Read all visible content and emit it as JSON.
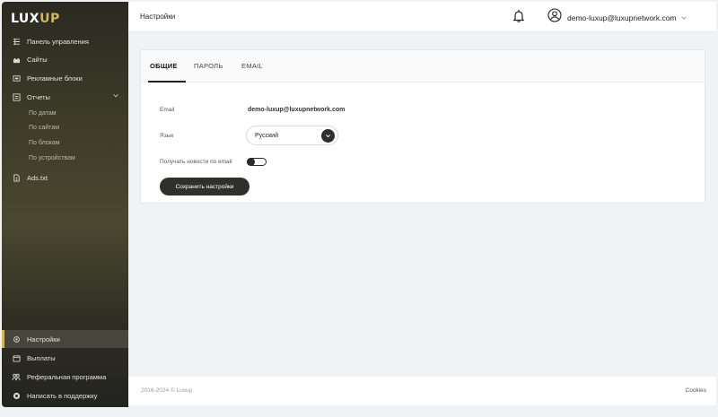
{
  "brand": {
    "logo_main": "LUX",
    "logo_accent": "UP",
    "accent_color": "#d6b94a"
  },
  "sidebar": {
    "items": [
      {
        "label": "Панель управления",
        "icon": "dashboard-icon"
      },
      {
        "label": "Сайты",
        "icon": "sites-icon"
      },
      {
        "label": "Рекламные блоки",
        "icon": "ad-block-icon"
      },
      {
        "label": "Отчеты",
        "icon": "report-icon"
      },
      {
        "label": "Ads.txt",
        "icon": "file-icon"
      }
    ],
    "report_subitems": [
      "По датам",
      "По сайтам",
      "По блокам",
      "По устройствам"
    ],
    "bottom_items": [
      {
        "label": "Настройки",
        "icon": "gear-icon",
        "active": true
      },
      {
        "label": "Выплаты",
        "icon": "wallet-icon"
      },
      {
        "label": "Реферальная программа",
        "icon": "referral-icon"
      },
      {
        "label": "Написать в поддержку",
        "icon": "support-icon"
      }
    ]
  },
  "header": {
    "title": "Настройки",
    "user_email": "demo-luxup@luxupnetwork.com"
  },
  "settings": {
    "tabs": [
      "ОБЩИЕ",
      "ПАРОЛЬ",
      "EMAIL"
    ],
    "active_tab": "ОБЩИЕ",
    "email_label": "Email",
    "email_value": "demo-luxup@luxupnetwork.com",
    "language_label": "Язык",
    "language_value": "Русский",
    "news_label": "Получать новости по email",
    "news_enabled": false,
    "save_label": "Сохранить настройки"
  },
  "footer": {
    "copyright": "2016-2024 © Luxup",
    "cookies": "Cookies"
  }
}
